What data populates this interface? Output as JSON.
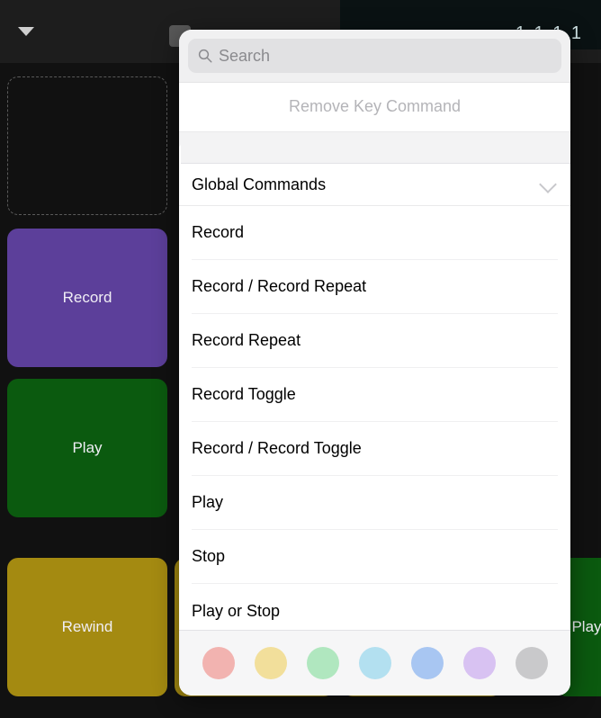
{
  "topbar": {
    "display_text": "1  1  1    1"
  },
  "pads": {
    "record": "Record",
    "play": "Play",
    "rewind": "Rewind",
    "play2": "Play"
  },
  "popover": {
    "search_placeholder": "Search",
    "remove_label": "Remove Key Command",
    "section_title": "Global Commands",
    "commands": [
      "Record",
      "Record / Record Repeat",
      "Record Repeat",
      "Record Toggle",
      "Record / Record Toggle",
      "Play",
      "Stop",
      "Play or Stop"
    ],
    "colors": [
      {
        "name": "red",
        "hex": "#f2b3b0"
      },
      {
        "name": "yellow",
        "hex": "#f2df9b"
      },
      {
        "name": "green",
        "hex": "#b0e7bf"
      },
      {
        "name": "cyan",
        "hex": "#b3e0f0"
      },
      {
        "name": "blue",
        "hex": "#a8c6f2"
      },
      {
        "name": "purple",
        "hex": "#d8c2f2"
      },
      {
        "name": "gray",
        "hex": "#c9c9cb"
      }
    ]
  }
}
